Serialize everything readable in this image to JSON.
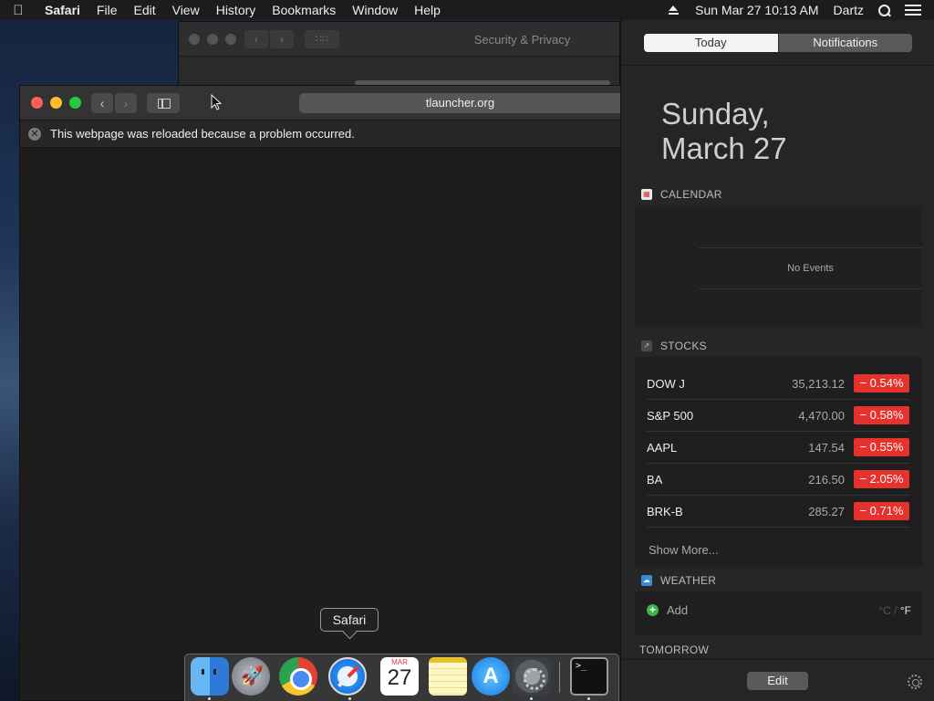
{
  "menubar": {
    "app": "Safari",
    "items": [
      "File",
      "Edit",
      "View",
      "History",
      "Bookmarks",
      "Window",
      "Help"
    ],
    "clock": "Sun Mar 27  10:13 AM",
    "user": "Dartz"
  },
  "background_window": {
    "title": "Security & Privacy"
  },
  "safari": {
    "url": "tlauncher.org",
    "banner": "This webpage was reloaded because a problem occurred."
  },
  "notification_center": {
    "tabs": {
      "today": "Today",
      "notifications": "Notifications"
    },
    "date": {
      "weekday": "Sunday,",
      "day": "March 27"
    },
    "calendar": {
      "title": "CALENDAR",
      "empty": "No Events"
    },
    "stocks": {
      "title": "STOCKS",
      "rows": [
        {
          "symbol": "DOW J",
          "price": "35,213.12",
          "change": "− 0.54%"
        },
        {
          "symbol": "S&P 500",
          "price": "4,470.00",
          "change": "− 0.58%"
        },
        {
          "symbol": "AAPL",
          "price": "147.54",
          "change": "− 0.55%"
        },
        {
          "symbol": "BA",
          "price": "216.50",
          "change": "− 2.05%"
        },
        {
          "symbol": "BRK-B",
          "price": "285.27",
          "change": "− 0.71%"
        }
      ],
      "more": "Show More...",
      "change_color": "#e5322d"
    },
    "weather": {
      "title": "WEATHER",
      "add": "Add",
      "unit_c": "°C",
      "unit_sep": "/",
      "unit_f": "°F"
    },
    "tomorrow": "TOMORROW",
    "edit": "Edit"
  },
  "dock": {
    "tooltip": "Safari",
    "calendar_month": "MAR",
    "calendar_day": "27",
    "apps": [
      "finder-icon",
      "launchpad-icon",
      "chrome-icon",
      "safari-icon",
      "calendar-icon",
      "notes-icon",
      "app-store-icon",
      "system-preferences-icon",
      "terminal-icon"
    ]
  }
}
